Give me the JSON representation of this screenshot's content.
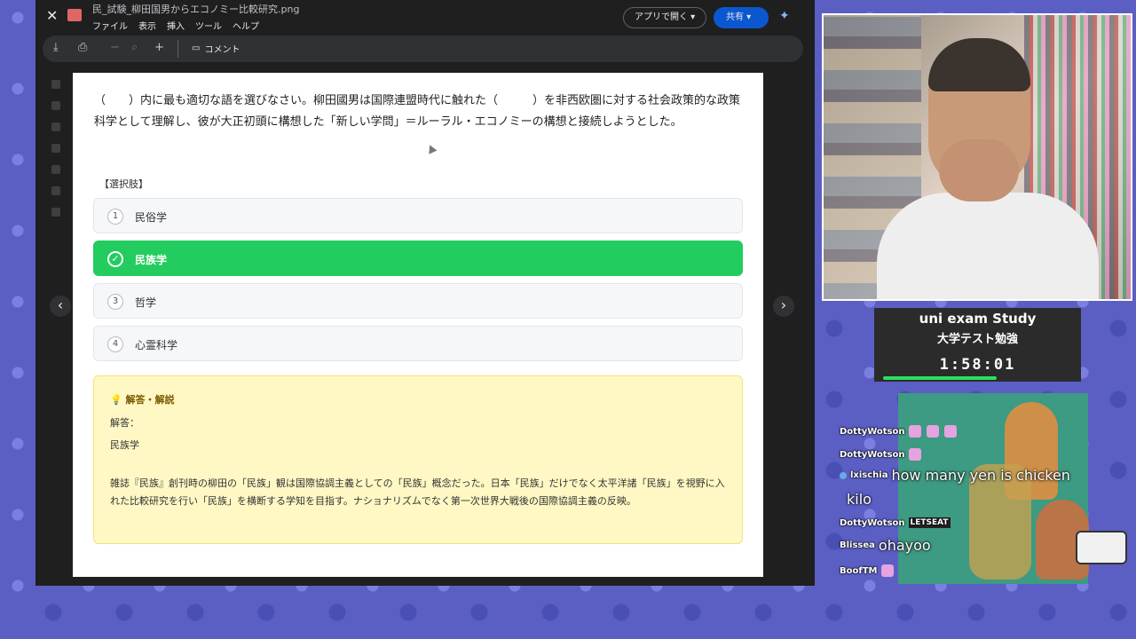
{
  "viewer": {
    "filename": "民_試験_柳田国男からエコノミー比較研究.png",
    "menu": [
      "ファイル",
      "表示",
      "挿入",
      "ツール",
      "ヘルプ"
    ],
    "open_in_app_label": "アプリで開く ▾",
    "share_label": "共有 ▾",
    "comment_label": "コメント"
  },
  "question": {
    "text": "（　　）内に最も適切な語を選びなさい。柳田國男は国際連盟時代に触れた（　　　）を非西欧圏に対する社会政策的な政策科学として理解し、彼が大正初頭に構想した「新しい学問」＝ルーラル・エコノミーの構想と接続しようとした。",
    "choices_label": "【選択肢】",
    "choices": [
      {
        "num": "1",
        "text": "民俗学",
        "selected": false
      },
      {
        "num": "✓",
        "text": "民族学",
        "selected": true
      },
      {
        "num": "3",
        "text": "哲学",
        "selected": false
      },
      {
        "num": "4",
        "text": "心霊科学",
        "selected": false
      }
    ]
  },
  "answer": {
    "title": "💡 解答・解説",
    "label": "解答：",
    "value": "民族学",
    "explanation": "雑誌『民族』創刊時の柳田の「民族」観は国際協調主義としての「民族」概念だった。日本「民族」だけでなく太平洋諸「民族」を視野に入れた比較研究を行い「民族」を横断する学知を目指す。ナショナリズムでなく第一次世界大戦後の国際協調主義の反映。"
  },
  "timer": {
    "title1": "uni exam Study",
    "title2": "大学テスト勉強",
    "time": "1:58:01",
    "progress_fraction": 0.6
  },
  "chat": [
    {
      "user": "DottyWotson",
      "msg": ""
    },
    {
      "user": "DottyWotson",
      "msg": ""
    },
    {
      "user": "lxischia",
      "msg": "how many yen is chicken"
    },
    {
      "user": "DottyWotson",
      "msg": "LETSEAT"
    },
    {
      "user": "Blissea",
      "msg": "ohayoo"
    },
    {
      "user": "BoofTM",
      "msg": ""
    }
  ],
  "chat_continuation": "kilo",
  "colors": {
    "accent_green": "#22cc5e",
    "answer_bg": "#fff8c4",
    "share_blue": "#0b57d0"
  }
}
